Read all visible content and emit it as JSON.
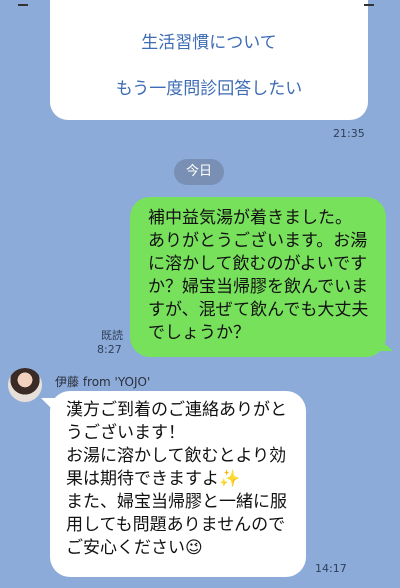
{
  "colors": {
    "background": "#8CABD8",
    "outgoing_bubble": "#78E15C",
    "incoming_bubble": "#FFFFFF",
    "link": "#3D6BB4"
  },
  "card": {
    "links": [
      "生活習慣について",
      "もう一度問診回答したい"
    ],
    "time": "21:35"
  },
  "date_separator": "今日",
  "outgoing": {
    "text": "補中益気湯が着きました。\nありがとうございます。お湯に溶かして飲むのがよいですか？婦宝当帰膠を飲んでいますが、混ぜて飲んでも大丈夫でしょうか？",
    "read_label": "既読",
    "time": "8:27"
  },
  "incoming": {
    "sender": "伊藤 from 'YOJO'",
    "text": "漢方ご到着のご連絡ありがとうございます！\nお湯に溶かして飲むとより効果は期待できますよ✨\nまた、婦宝当帰膠と一緒に服用しても問題ありませんのでご安心ください😉",
    "time": "14:17"
  }
}
